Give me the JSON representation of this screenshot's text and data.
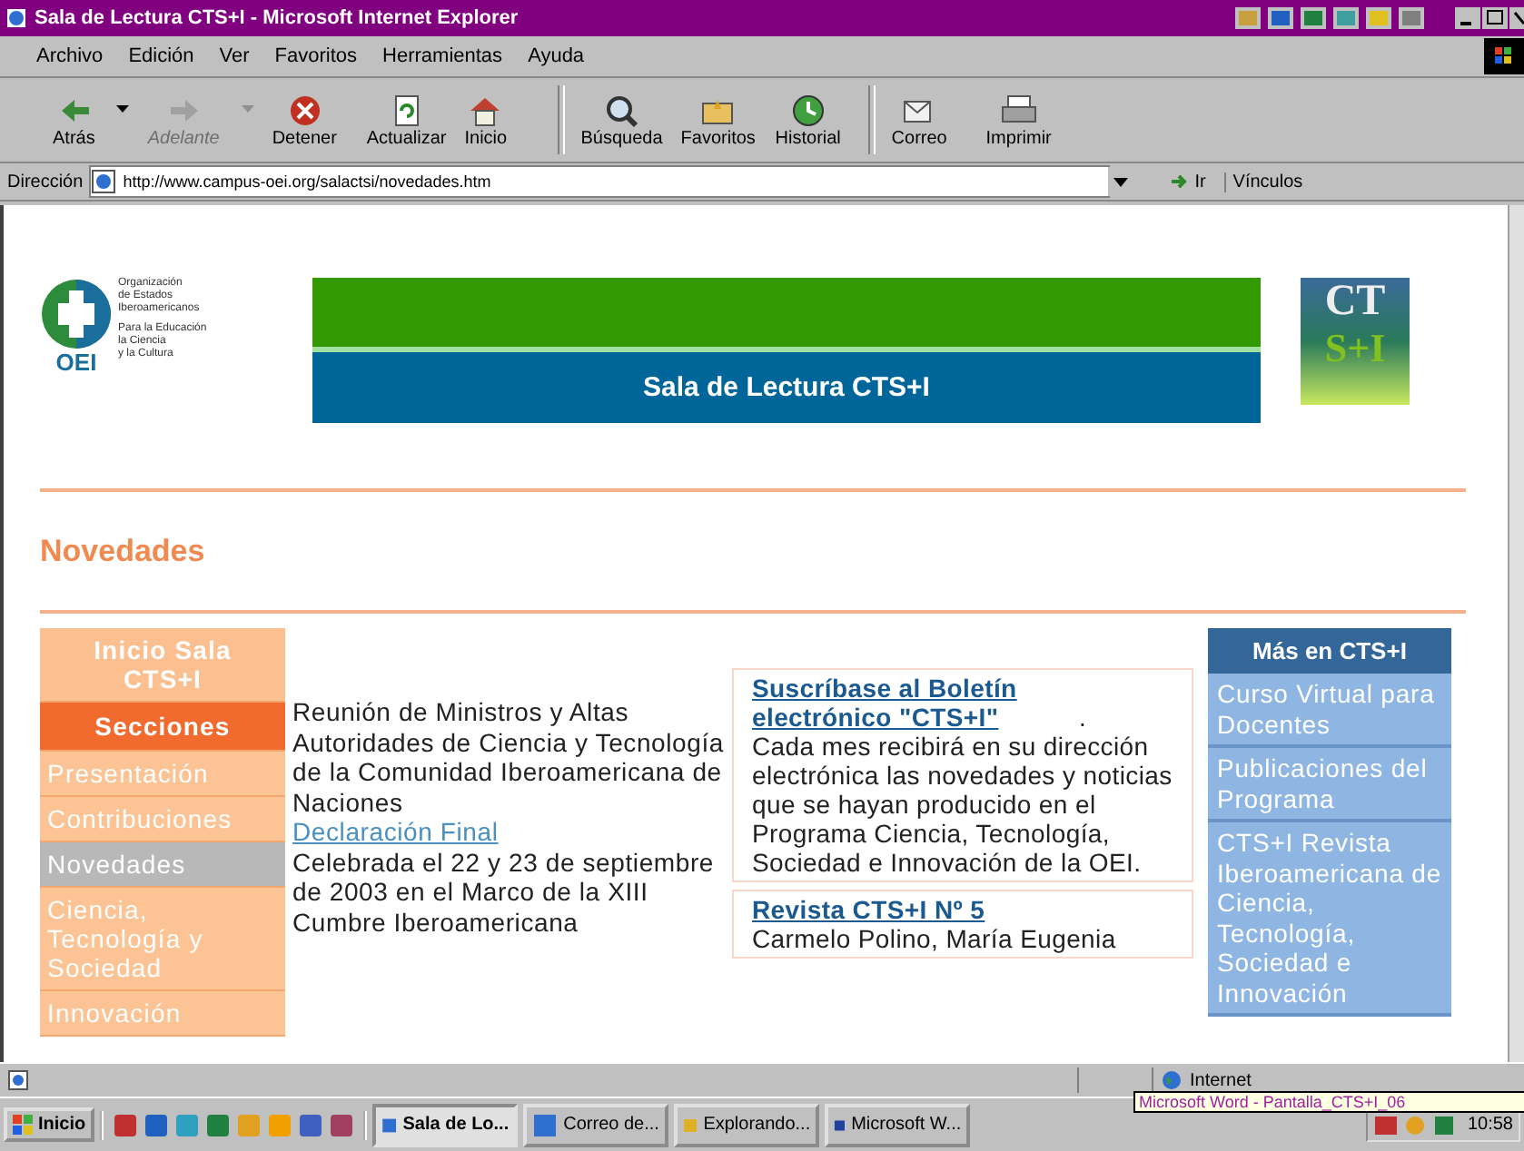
{
  "window": {
    "title": "Sala de Lectura CTS+I - Microsoft Internet Explorer"
  },
  "menu": [
    "Archivo",
    "Edición",
    "Ver",
    "Favoritos",
    "Herramientas",
    "Ayuda"
  ],
  "toolbar": [
    {
      "label": "Atrás",
      "kind": "back",
      "disabled": false,
      "dropdown": true
    },
    {
      "label": "Adelante",
      "kind": "forward",
      "disabled": true,
      "dropdown": true
    },
    {
      "label": "Detener",
      "kind": "stop",
      "disabled": false,
      "dropdown": false
    },
    {
      "label": "Actualizar",
      "kind": "refresh",
      "disabled": false,
      "dropdown": false
    },
    {
      "label": "Inicio",
      "kind": "home",
      "disabled": false,
      "dropdown": false
    },
    {
      "label": "Búsqueda",
      "kind": "search",
      "disabled": false,
      "dropdown": false
    },
    {
      "label": "Favoritos",
      "kind": "favorites",
      "disabled": false,
      "dropdown": false
    },
    {
      "label": "Historial",
      "kind": "history",
      "disabled": false,
      "dropdown": false
    },
    {
      "label": "Correo",
      "kind": "mail",
      "disabled": false,
      "dropdown": false
    },
    {
      "label": "Imprimir",
      "kind": "print",
      "disabled": false,
      "dropdown": false
    }
  ],
  "address": {
    "label": "Dirección",
    "value": "http://www.campus-oei.org/salactsi/novedades.htm",
    "go": "Ir",
    "links": "Vínculos"
  },
  "page": {
    "logo": {
      "mark": "OEI",
      "org_lines": [
        "Organización",
        "de Estados",
        "Iberoamericanos"
      ],
      "sub_lines": [
        "Para la Educación",
        "la Ciencia",
        "y la Cultura"
      ]
    },
    "banner_title": "Sala de Lectura CTS+I",
    "badge": {
      "top": "CT",
      "bottom": "S+I"
    },
    "heading": "Novedades",
    "left_nav": [
      {
        "label": "Inicio Sala CTS+I",
        "kind": "home"
      },
      {
        "label": "Secciones",
        "kind": "header"
      },
      {
        "label": "Presentación",
        "kind": "link",
        "selected": false
      },
      {
        "label": "Contribuciones",
        "kind": "link",
        "selected": false
      },
      {
        "label": "Novedades",
        "kind": "link",
        "selected": true
      },
      {
        "label": "Ciencia, Tecnología y Sociedad",
        "kind": "link",
        "selected": false
      },
      {
        "label": "Innovación",
        "kind": "link",
        "selected": false
      }
    ],
    "news": {
      "text": "Reunión de Ministros y Altas Autoridades de Ciencia y Tecnología de la Comunidad Iberoamericana de Naciones",
      "link": "Declaración Final",
      "after": "Celebrada el 22 y 23 de septiembre de 2003 en el Marco de la XIII Cumbre Iberoamericana"
    },
    "boxes": [
      {
        "title": "Suscríbase al Boletín electrónico \"CTS+I\"",
        "title_end": ".",
        "body": "Cada mes recibirá en su dirección electrónica las novedades y noticias que se hayan producido en el Programa Ciencia, Tecnología, Sociedad e Innovación de la OEI."
      },
      {
        "title": "Revista CTS+I Nº 5",
        "body": "Carmelo Polino, María Eugenia"
      }
    ],
    "right_nav": {
      "title": "Más en CTS+I",
      "items": [
        "Curso Virtual para Docentes",
        "Publicaciones del Programa",
        "CTS+I Revista Iberoamericana de Ciencia, Tecnología, Sociedad e Innovación"
      ]
    }
  },
  "status_bar": {
    "zone": "Internet"
  },
  "taskbar": {
    "start": "Inicio",
    "tasks": [
      {
        "label": "Sala de Lo...",
        "kind": "ie",
        "selected": true
      },
      {
        "label": "Correo de...",
        "kind": "mail",
        "selected": false
      },
      {
        "label": "Explorando...",
        "kind": "folder",
        "selected": false
      },
      {
        "label": "Microsoft W...",
        "kind": "word",
        "selected": false
      }
    ],
    "clock": "10:58",
    "tooltip": "Microsoft Word - Pantalla_CTS+I_06"
  }
}
